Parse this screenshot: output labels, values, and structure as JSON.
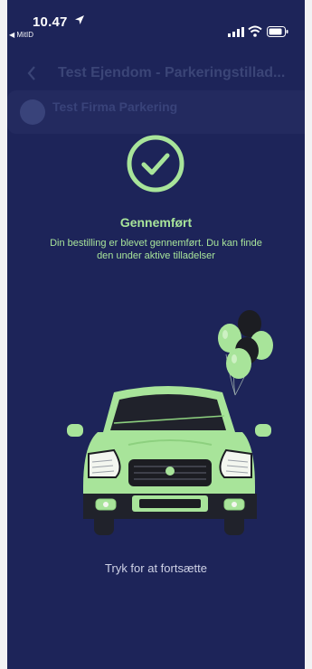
{
  "status_bar": {
    "time": "10.47",
    "back_app": "◀ MitID",
    "icons": [
      "location-arrow-icon",
      "signal-icon",
      "wifi-icon",
      "battery-icon"
    ]
  },
  "background_page": {
    "title": "Test Ejendom - Parkeringstillad...",
    "card_label": "Test Firma Parkering"
  },
  "success": {
    "icon": "check-circle-icon",
    "title": "Gennemført",
    "message": "Din bestilling er blevet gennemført. Du kan finde den under aktive tilladelser"
  },
  "illustration": {
    "subject": "green car with balloons",
    "icons": [
      "car-illustration",
      "balloons-illustration"
    ]
  },
  "continue_text": "Tryk for at fortsætte",
  "colors": {
    "background": "#1d2459",
    "accent_green": "#a8e49a",
    "muted_text": "#cfd2e6"
  }
}
